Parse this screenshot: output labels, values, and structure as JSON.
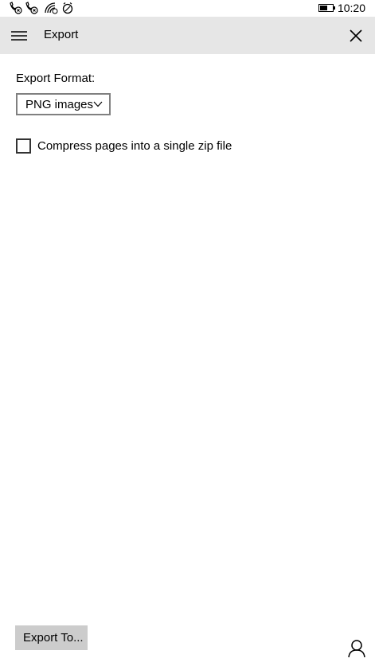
{
  "status_bar": {
    "time": "10:20",
    "icons": [
      "missed-call-icon",
      "missed-call-icon",
      "wifi-icon",
      "alarm-icon",
      "battery-icon"
    ]
  },
  "header": {
    "title": "Export",
    "menu_icon": "hamburger-icon",
    "close_icon": "close-icon",
    "background": "#e6e6e6"
  },
  "export_format": {
    "label": "Export Format:",
    "selected": "PNG images"
  },
  "compress_option": {
    "label": "Compress pages into a single zip file",
    "checked": false
  },
  "footer": {
    "export_button_label": "Export To...",
    "account_icon": "person-icon"
  }
}
